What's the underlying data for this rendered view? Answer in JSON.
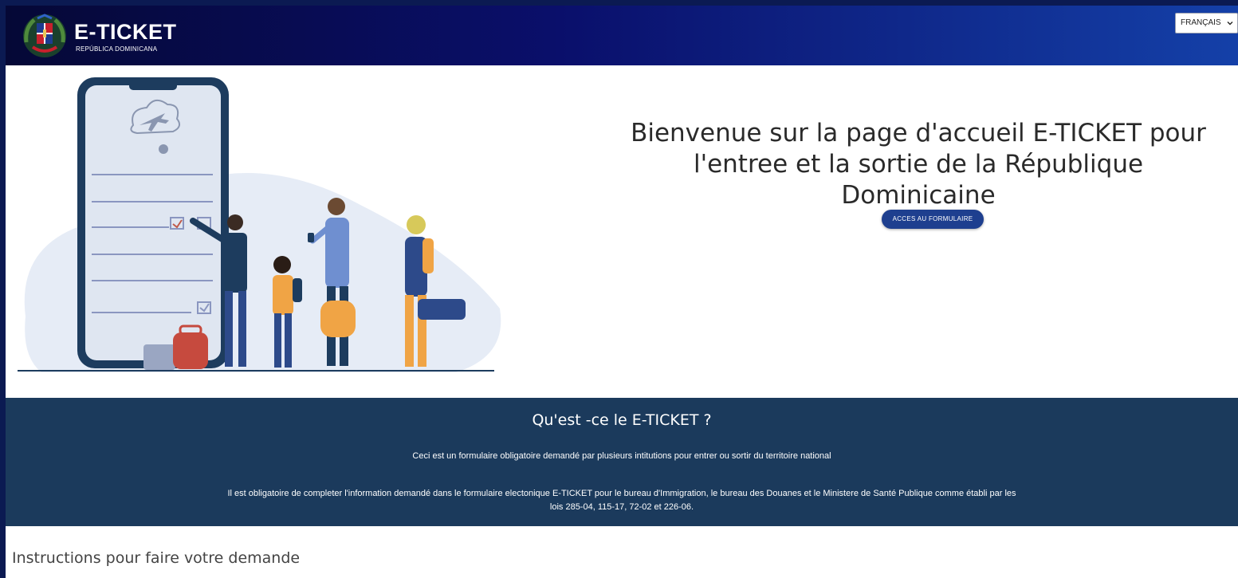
{
  "header": {
    "brand_title": "E-TICKET",
    "brand_subtitle": "REPÚBLICA DOMINICANA",
    "language_select": "FRANÇAIS"
  },
  "hero": {
    "title": "Bienvenue sur la page d'accueil E-TICKET pour l'entree et la sortie de la République Dominicaine",
    "cta_label": "ACCES AU FORMULAIRE"
  },
  "info": {
    "title": "Qu'est -ce le E-TICKET ?",
    "paragraph_1": "Ceci est un formulaire obligatoire demandé par plusieurs intitutions pour entrer ou sortir du territoire national",
    "paragraph_2": "Il est obligatoire de completer l'information demandé dans le formulaire electonique E-TICKET pour le bureau d'Immigration, le bureau des Douanes et le Ministere de Santé Publique comme établi par les lois 285-04, 115-17, 72-02 et 226-06."
  },
  "instructions": {
    "heading": "Instructions pour faire votre demande"
  },
  "colors": {
    "header_gradient_start": "#050836",
    "header_gradient_end": "#1440a8",
    "cta_background": "#1e3f8f",
    "info_band_background": "#1b3a5c"
  },
  "icons": {
    "emblem": "coat-of-arms-icon",
    "language_dropdown": "chevron-down-icon"
  }
}
